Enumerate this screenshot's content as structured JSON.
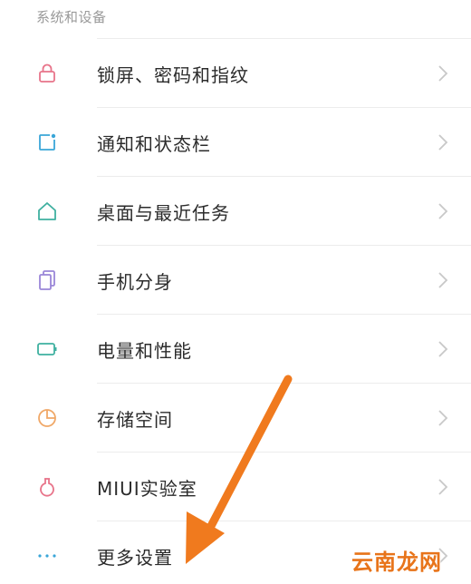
{
  "section": {
    "title": "系统和设备"
  },
  "items": [
    {
      "label": "锁屏、密码和指纹",
      "icon": "lock-icon"
    },
    {
      "label": "通知和状态栏",
      "icon": "notification-icon"
    },
    {
      "label": "桌面与最近任务",
      "icon": "home-icon"
    },
    {
      "label": "手机分身",
      "icon": "dual-phone-icon"
    },
    {
      "label": "电量和性能",
      "icon": "battery-icon"
    },
    {
      "label": "存储空间",
      "icon": "storage-pie-icon"
    },
    {
      "label": "MIUI实验室",
      "icon": "lab-flask-icon"
    },
    {
      "label": "更多设置",
      "icon": "more-dots-icon"
    }
  ],
  "colors": {
    "lock": "#e8748a",
    "notification": "#3aa6d8",
    "home": "#3fb0a0",
    "dual": "#9a86d8",
    "battery": "#3fb0a0",
    "storage": "#f0a868",
    "lab": "#e8748a",
    "more": "#3aa6d8",
    "arrow": "#f07a1e",
    "chevron": "#c8c8c8"
  },
  "watermark": {
    "text": "云南龙网"
  }
}
